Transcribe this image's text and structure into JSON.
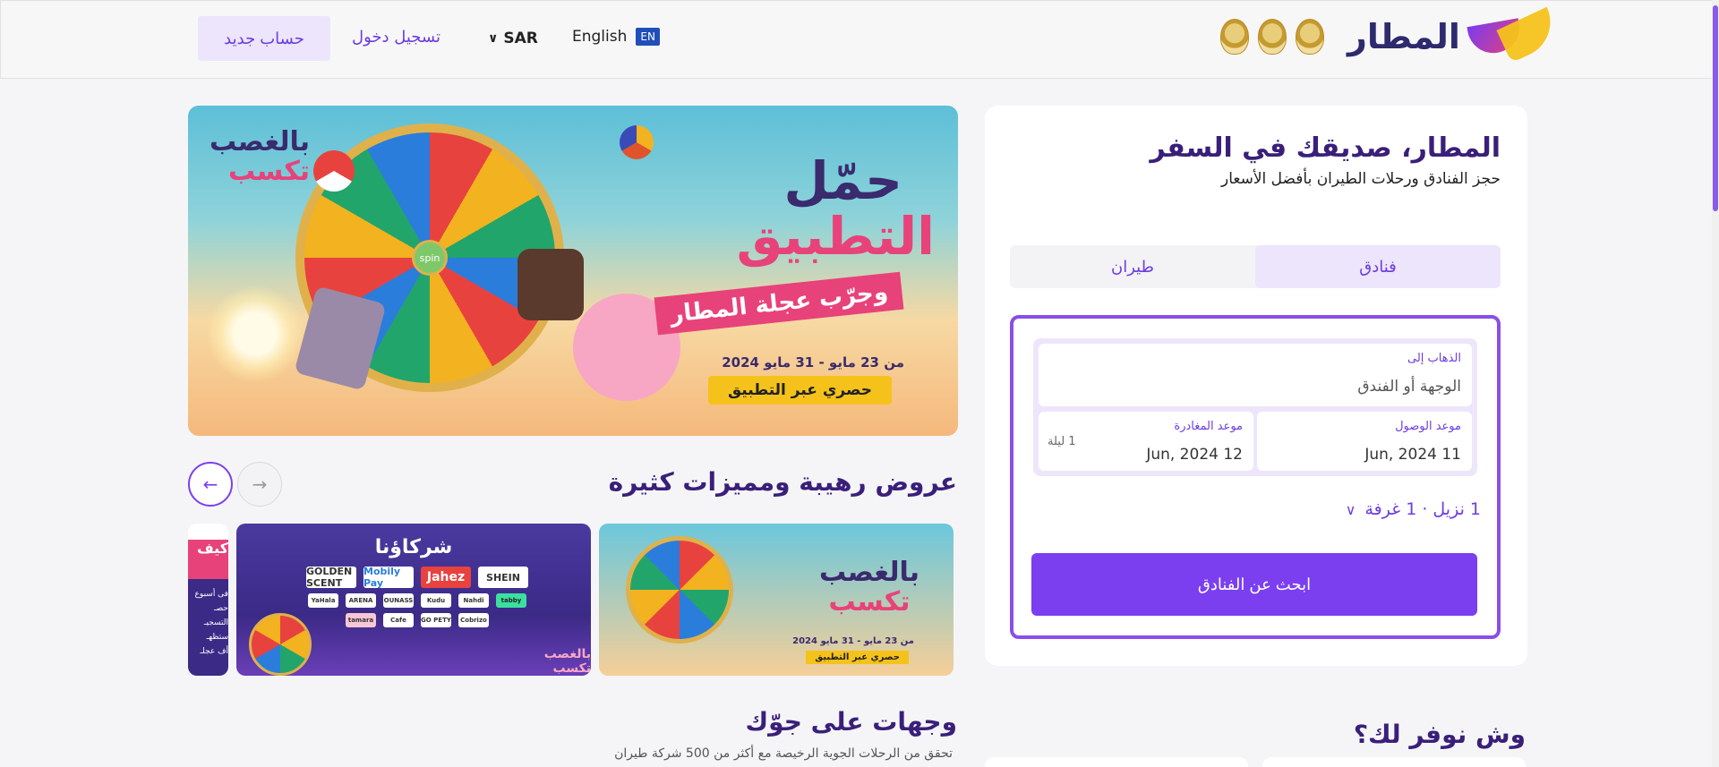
{
  "header": {
    "logo_text": "المطار",
    "signup_label": "حساب جديد",
    "login_label": "تسجيل دخول",
    "currency": "SAR",
    "language": "English",
    "language_badge": "EN"
  },
  "search_card": {
    "title": "المطار، صديقك في السفر",
    "subtitle": "حجز الفنادق ورحلات الطيران بأفضل الأسعار",
    "tabs": [
      {
        "label": "فنادق",
        "active": true
      },
      {
        "label": "طيران",
        "active": false
      }
    ],
    "destination_label": "الذهاب إلى",
    "destination_placeholder": "الوجهة أو الفندق",
    "checkin_label": "موعد الوصول",
    "checkin_value": "11 Jun, 2024",
    "checkout_label": "موعد المغادرة",
    "checkout_value": "12 Jun, 2024",
    "nights": "1 ليلة",
    "guests": "1 نزيل · 1 غرفة",
    "search_button": "ابحث عن الفنادق"
  },
  "hero": {
    "line1": "حمّل",
    "line2": "التطبيق",
    "line3": "وجرّب عجلة المطار",
    "dates": "من 23 مايو - 31 مايو 2024",
    "exclusive": "حصري عبر التطبيق",
    "corner_top": "بالغصب",
    "corner_bottom": "تكسب",
    "wheel_hub": "spin"
  },
  "offers": {
    "title": "عروض رهيبة ومميزات كثيرة",
    "cards": [
      {
        "top": "بالغصب",
        "bottom": "تكسب",
        "dates": "من 23 مايو - 31 مايو 2024",
        "cta": "حصري عبر التطبيق"
      },
      {
        "title": "شركاؤنا",
        "logos_big": [
          "GOLDEN SCENT",
          "Mobily Pay",
          "Jahez",
          "SHEIN"
        ],
        "logos_small": [
          "YaHala",
          "ARENA",
          "OUNASS",
          "Kudu",
          "Nahdi",
          "tabby",
          "tamara",
          "Cafe",
          "GO PETY",
          "Cobrizo"
        ],
        "tag": "بالغصب تكسب"
      },
      {
        "title": "كيف",
        "lines": [
          "فى أسبوع",
          "حصـ",
          "التسجيـ",
          "ستظهـ",
          "أف عجلـ"
        ]
      }
    ]
  },
  "destinations": {
    "title": "وجهات على جوّك",
    "subtitle": "تحقق من الرحلات الجوية الرخيصة مع أكثر من 500 شركة طيران"
  },
  "provide": {
    "title": "وش نوفر لك؟"
  },
  "colors": {
    "primary": "#7b3ff0",
    "title": "#3a1f7a",
    "accent_pink": "#e8427a",
    "accent_yellow": "#f5c21b"
  }
}
